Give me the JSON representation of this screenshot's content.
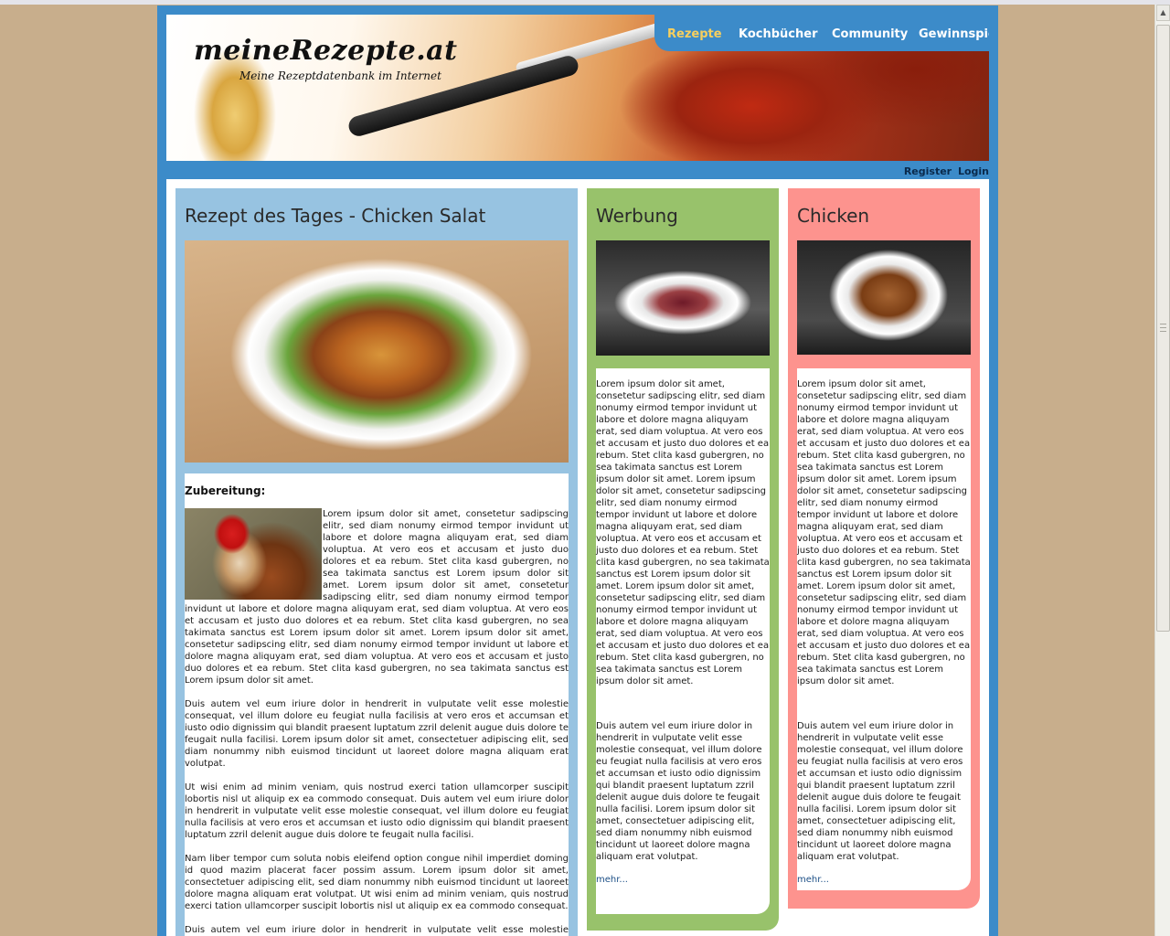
{
  "site": {
    "logo": "meineRezepte.at",
    "tagline": "Meine Rezeptdatenbank im Internet"
  },
  "nav": {
    "items": [
      "Rezepte",
      "Kochbücher",
      "Community",
      "Gewinnspiel"
    ],
    "active_index": 0
  },
  "auth": {
    "register": "Register",
    "login": "Login"
  },
  "colors": {
    "page_background": "#c8ae8c",
    "frame_blue": "#3c8bc9",
    "nav_active": "#f7cf5e",
    "column_blue": "#97c3e1",
    "column_green": "#98c26b",
    "column_pink": "#fd938e"
  },
  "featured": {
    "title": "Rezept des Tages - Chicken Salat",
    "subtitle": "Zubereitung:",
    "paragraphs": [
      "Lorem ipsum dolor sit amet, consetetur sadipscing elitr, sed diam nonumy eirmod tempor invidunt ut labore et dolore magna aliquyam erat, sed diam voluptua. At vero eos et accusam et justo duo dolores et ea rebum. Stet clita kasd gubergren, no sea takimata sanctus est Lorem ipsum dolor sit amet. Lorem ipsum dolor sit amet, consetetur sadipscing elitr, sed diam nonumy eirmod tempor invidunt ut labore et dolore magna aliquyam erat, sed diam voluptua. At vero eos et accusam et justo duo dolores et ea rebum. Stet clita kasd gubergren, no sea takimata sanctus est Lorem ipsum dolor sit amet. Lorem ipsum dolor sit amet, consetetur sadipscing elitr, sed diam nonumy eirmod tempor invidunt ut labore et dolore magna aliquyam erat, sed diam voluptua. At vero eos et accusam et justo duo dolores et ea rebum. Stet clita kasd gubergren, no sea takimata sanctus est Lorem ipsum dolor sit amet.",
      "Duis autem vel eum iriure dolor in hendrerit in vulputate velit esse molestie consequat, vel illum dolore eu feugiat nulla facilisis at vero eros et accumsan et iusto odio dignissim qui blandit praesent luptatum zzril delenit augue duis dolore te feugait nulla facilisi. Lorem ipsum dolor sit amet, consectetuer adipiscing elit, sed diam nonummy nibh euismod tincidunt ut laoreet dolore magna aliquam erat volutpat.",
      "Ut wisi enim ad minim veniam, quis nostrud exerci tation ullamcorper suscipit lobortis nisl ut aliquip ex ea commodo consequat. Duis autem vel eum iriure dolor in hendrerit in vulputate velit esse molestie consequat, vel illum dolore eu feugiat nulla facilisis at vero eros et accumsan et iusto odio dignissim qui blandit praesent luptatum zzril delenit augue duis dolore te feugait nulla facilisi.",
      "Nam liber tempor cum soluta nobis eleifend option congue nihil imperdiet doming id quod mazim placerat facer possim assum. Lorem ipsum dolor sit amet, consectetuer adipiscing elit, sed diam nonummy nibh euismod tincidunt ut laoreet dolore magna aliquam erat volutpat. Ut wisi enim ad minim veniam, quis nostrud exerci tation ullamcorper suscipit lobortis nisl ut aliquip ex ea commodo consequat.",
      "Duis autem vel eum iriure dolor in hendrerit in vulputate velit esse molestie consequat, vel illum dolore eu feugiat nulla facilisis."
    ]
  },
  "werbung": {
    "title": "Werbung",
    "paragraphs": [
      "Lorem ipsum dolor sit amet, consetetur sadipscing elitr, sed diam nonumy eirmod tempor invidunt ut labore et dolore magna aliquyam erat, sed diam voluptua. At vero eos et accusam et justo duo dolores et ea rebum. Stet clita kasd gubergren, no sea takimata sanctus est Lorem ipsum dolor sit amet. Lorem ipsum dolor sit amet, consetetur sadipscing elitr, sed diam nonumy eirmod tempor invidunt ut labore et dolore magna aliquyam erat, sed diam voluptua. At vero eos et accusam et justo duo dolores et ea rebum. Stet clita kasd gubergren, no sea takimata sanctus est Lorem ipsum dolor sit amet. Lorem ipsum dolor sit amet, consetetur sadipscing elitr, sed diam nonumy eirmod tempor invidunt ut labore et dolore magna aliquyam erat, sed diam voluptua. At vero eos et accusam et justo duo dolores et ea rebum. Stet clita kasd gubergren, no sea takimata sanctus est Lorem ipsum dolor sit amet.",
      "Duis autem vel eum iriure dolor in hendrerit in vulputate velit esse molestie consequat, vel illum dolore eu feugiat nulla facilisis at vero eros et accumsan et iusto odio dignissim qui blandit praesent luptatum zzril delenit augue duis dolore te feugait nulla facilisi. Lorem ipsum dolor sit amet, consectetuer adipiscing elit, sed diam nonummy nibh euismod tincidunt ut laoreet dolore magna aliquam erat volutpat."
    ],
    "more": "mehr..."
  },
  "chicken": {
    "title": "Chicken",
    "paragraphs": [
      "Lorem ipsum dolor sit amet, consetetur sadipscing elitr, sed diam nonumy eirmod tempor invidunt ut labore et dolore magna aliquyam erat, sed diam voluptua. At vero eos et accusam et justo duo dolores et ea rebum. Stet clita kasd gubergren, no sea takimata sanctus est Lorem ipsum dolor sit amet. Lorem ipsum dolor sit amet, consetetur sadipscing elitr, sed diam nonumy eirmod tempor invidunt ut labore et dolore magna aliquyam erat, sed diam voluptua. At vero eos et accusam et justo duo dolores et ea rebum. Stet clita kasd gubergren, no sea takimata sanctus est Lorem ipsum dolor sit amet. Lorem ipsum dolor sit amet, consetetur sadipscing elitr, sed diam nonumy eirmod tempor invidunt ut labore et dolore magna aliquyam erat, sed diam voluptua. At vero eos et accusam et justo duo dolores et ea rebum. Stet clita kasd gubergren, no sea takimata sanctus est Lorem ipsum dolor sit amet.",
      "Duis autem vel eum iriure dolor in hendrerit in vulputate velit esse molestie consequat, vel illum dolore eu feugiat nulla facilisis at vero eros et accumsan et iusto odio dignissim qui blandit praesent luptatum zzril delenit augue duis dolore te feugait nulla facilisi. Lorem ipsum dolor sit amet, consectetuer adipiscing elit, sed diam nonummy nibh euismod tincidunt ut laoreet dolore magna aliquam erat volutpat."
    ],
    "more": "mehr..."
  },
  "scrollbar": {
    "up_arrow_icon": "triangle-up-icon",
    "grip_icon": "grip-lines-icon"
  }
}
